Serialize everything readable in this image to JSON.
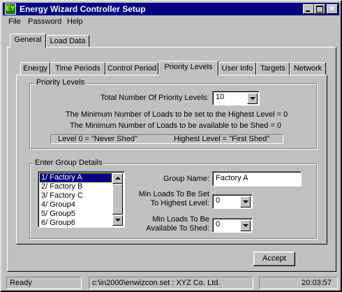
{
  "window": {
    "title": "Energy Wizard Controller Setup",
    "icon_glyph": "EY"
  },
  "menu": [
    {
      "label": "File"
    },
    {
      "label": "Password"
    },
    {
      "label": "Help"
    }
  ],
  "outer_tabs": [
    "General",
    "Load Data"
  ],
  "inner_tabs": [
    "Energy",
    "Time Periods",
    "Control Period",
    "Priority Levels",
    "User Info",
    "Targets",
    "Network"
  ],
  "priority_levels": {
    "group_title": "Priority Levels",
    "total_label": "Total Number Of Priority Levels:",
    "total_value": "10",
    "min_highest_text": "The Minimum Number of Loads to be set to the Highest Level = 0",
    "min_shed_text": "The Minimum Number of Loads to be available to be Shed = 0",
    "level0_text": "Level 0 = \"Never Shed\"",
    "highest_text": "Highest Level = \"First Shed\""
  },
  "group_details": {
    "group_title": "Enter Group Details",
    "list_items": [
      "1/ Factory A",
      "2/ Factory B",
      "3/ Factory C",
      "4/ Group4",
      "5/ Group5",
      "6/ Group6"
    ],
    "selected_index": 0,
    "group_name_label": "Group Name:",
    "group_name_value": "Factory A",
    "min_highest_label_1": "Min Loads To Be Set",
    "min_highest_label_2": "To Highest Level:",
    "min_highest_value": "0",
    "min_shed_label_1": "Min Loads To Be",
    "min_shed_label_2": "Available To Shed:",
    "min_shed_value": "0"
  },
  "accept_label": "Accept",
  "status": {
    "state": "Ready",
    "file": "c:\\in2000\\enwizcon.set : XYZ Co. Ltd.",
    "time": "20:03:57"
  },
  "colors": {
    "titlebar": "#000080",
    "face": "#c0c0c0",
    "selection": "#000080"
  }
}
